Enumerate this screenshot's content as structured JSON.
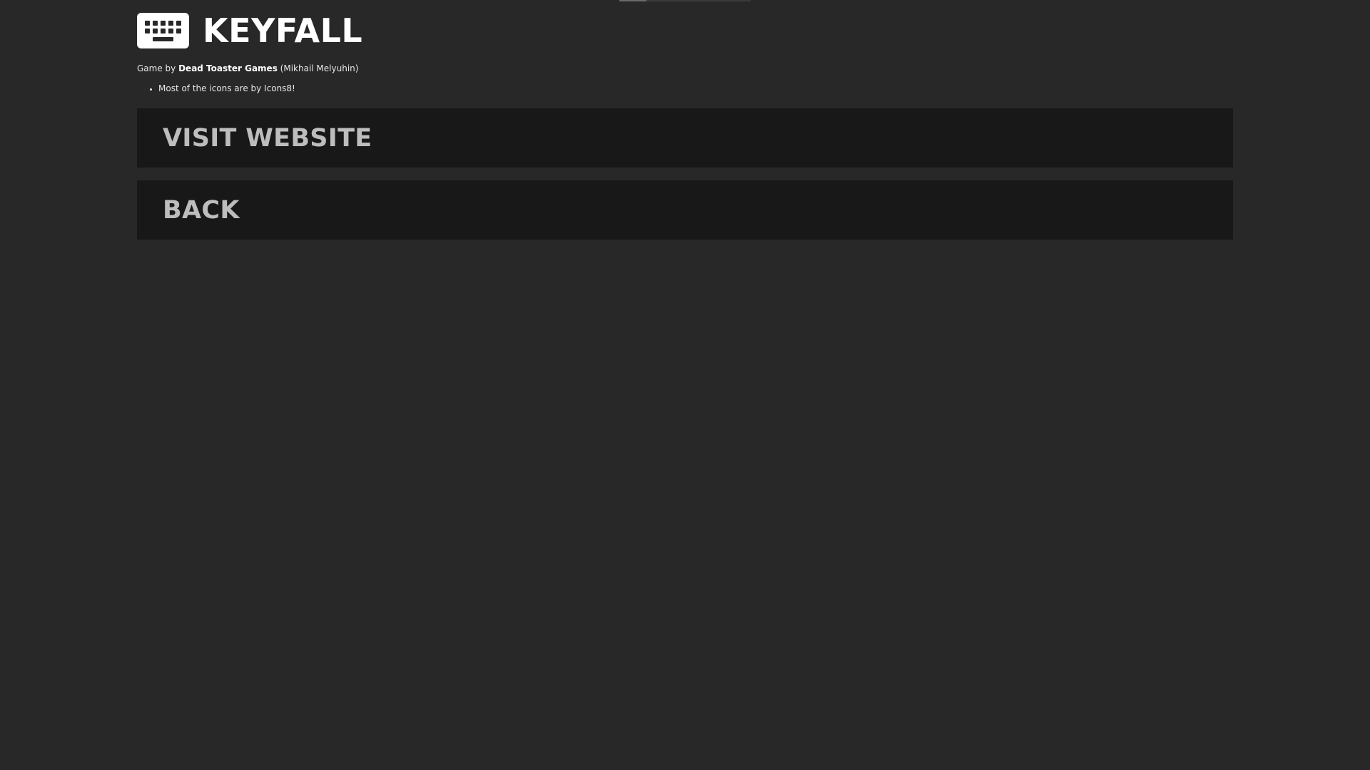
{
  "game": {
    "title": "KEYFALL",
    "logo_icon": "keyboard-icon"
  },
  "credits": {
    "prefix": "Game by",
    "studio": "Dead Toaster Games",
    "author": "(Mikhail Melyuhin)",
    "notes": [
      "Most of the icons are by Icons8!"
    ]
  },
  "menu": {
    "visit_website_label": "VISIT WEBSITE",
    "back_label": "BACK"
  },
  "colors": {
    "background": "#282828",
    "button_background": "#181818",
    "button_text": "#bdbdbd",
    "text": "#ffffff"
  }
}
